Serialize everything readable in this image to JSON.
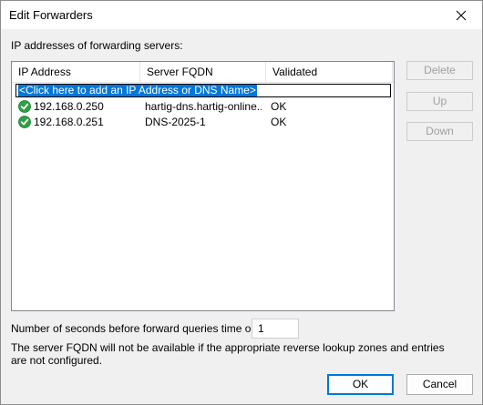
{
  "window": {
    "title": "Edit Forwarders"
  },
  "list": {
    "label": "IP addresses of forwarding servers:",
    "columns": [
      "IP Address",
      "Server FQDN",
      "Validated"
    ],
    "add_prompt": "<Click here to add an IP Address or DNS Name>",
    "rows": [
      {
        "ip": "192.168.0.250",
        "fqdn": "hartig-dns.hartig-online...",
        "validated": "OK",
        "icon": "validated-check-icon"
      },
      {
        "ip": "192.168.0.251",
        "fqdn": "DNS-2025-1",
        "validated": "OK",
        "icon": "validated-check-icon"
      }
    ]
  },
  "side_buttons": {
    "delete": "Delete",
    "up": "Up",
    "down": "Down"
  },
  "timeout": {
    "label": "Number of seconds before forward queries time out:",
    "value": "1"
  },
  "note": "The server FQDN will not be available if the appropriate reverse lookup zones and entries are not configured.",
  "buttons": {
    "ok": "OK",
    "cancel": "Cancel"
  },
  "colors": {
    "selection": "#0078d7",
    "check_green": "#2ea043",
    "dialog_bg": "#f0f0f0"
  }
}
